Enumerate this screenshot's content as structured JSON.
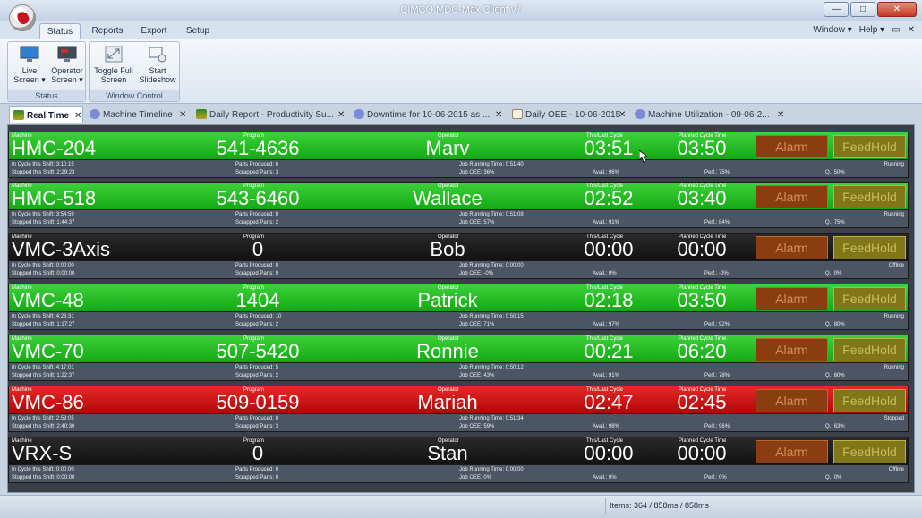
{
  "window": {
    "title": "CIMCO MDC-Max Client v7"
  },
  "ribbon": {
    "tabs": [
      "Status",
      "Reports",
      "Export",
      "Setup"
    ],
    "right_menus": [
      "Window",
      "Help"
    ],
    "groups": [
      {
        "label": "Status",
        "buttons": [
          "Live Screen",
          "Operator Screen"
        ]
      },
      {
        "label": "Window Control",
        "buttons": [
          "Toggle Full Screen",
          "Start Slideshow"
        ]
      }
    ]
  },
  "doc_tabs": [
    "Real Time",
    "Machine Timeline",
    "Daily Report - Productivity Su...",
    "Downtime for 10-06-2015 as ...",
    "Daily OEE - 10-06-2015",
    "Machine Utilization - 09-06-2..."
  ],
  "labels": {
    "machine": "Machine",
    "program": "Program",
    "operator": "Operator",
    "this_last_cycle": "This/Last Cycle",
    "planned_cycle_time": "Planned Cycle Time",
    "alarm": "Alarm",
    "feedhold": "FeedHold",
    "in_cycle": "In Cycle this Shift:",
    "stopped": "Stopped this Shift:",
    "parts_produced": "Parts Produced:",
    "scrapped_parts": "Scrapped Parts:",
    "job_running_time": "Job Running Time:",
    "job_oee": "Job OEE:",
    "avail": "Avail.:",
    "perf": "Perf.:",
    "q": "Q.:"
  },
  "machines": [
    {
      "state": "green",
      "name": "HMC-204",
      "program": "541-4636",
      "operator": "Marv",
      "this_last": "03:51",
      "planned": "03:50",
      "in_cycle": "3:10:15",
      "stopped": "2:29:23",
      "parts": "6",
      "scrapped": "3",
      "job_time": "0:51:40",
      "job_oee": "36%",
      "avail": "96%",
      "perf": "75%",
      "q": "50%",
      "status": "Running"
    },
    {
      "state": "green",
      "name": "HMC-518",
      "program": "543-6460",
      "operator": "Wallace",
      "this_last": "02:52",
      "planned": "03:40",
      "in_cycle": "3:54:59",
      "stopped": "1:44:37",
      "parts": "8",
      "scrapped": "2",
      "job_time": "0:51:08",
      "job_oee": "57%",
      "avail": "91%",
      "perf": "84%",
      "q": "75%",
      "status": "Running"
    },
    {
      "state": "black",
      "name": "VMC-3Axis",
      "program": "0",
      "operator": "Bob",
      "this_last": "00:00",
      "planned": "00:00",
      "in_cycle": "0:00:00",
      "stopped": "0:00:00",
      "parts": "0",
      "scrapped": "0",
      "job_time": "0:00:00",
      "job_oee": "-0%",
      "avail": "0%",
      "perf": "-0%",
      "q": "0%",
      "status": "Offline"
    },
    {
      "state": "green",
      "name": "VMC-48",
      "program": "1404",
      "operator": "Patrick",
      "this_last": "02:18",
      "planned": "03:50",
      "in_cycle": "4:26:31",
      "stopped": "1:17:27",
      "parts": "10",
      "scrapped": "2",
      "job_time": "0:50:15",
      "job_oee": "71%",
      "avail": "97%",
      "perf": "92%",
      "q": "80%",
      "status": "Running"
    },
    {
      "state": "green",
      "name": "VMC-70",
      "program": "507-5420",
      "operator": "Ronnie",
      "this_last": "00:21",
      "planned": "06:20",
      "in_cycle": "4:17:01",
      "stopped": "1:22:37",
      "parts": "5",
      "scrapped": "2",
      "job_time": "0:50:12",
      "job_oee": "43%",
      "avail": "91%",
      "perf": "78%",
      "q": "60%",
      "status": "Running"
    },
    {
      "state": "red",
      "name": "VMC-86",
      "program": "509-0159",
      "operator": "Mariah",
      "this_last": "02:47",
      "planned": "02:45",
      "in_cycle": "2:59:05",
      "stopped": "2:40:30",
      "parts": "8",
      "scrapped": "3",
      "job_time": "0:51:34",
      "job_oee": "59%",
      "avail": "98%",
      "perf": "96%",
      "q": "63%",
      "status": "Stopped"
    },
    {
      "state": "black",
      "name": "VRX-S",
      "program": "0",
      "operator": "Stan",
      "this_last": "00:00",
      "planned": "00:00",
      "in_cycle": "0:00:00",
      "stopped": "0:00:00",
      "parts": "0",
      "scrapped": "0",
      "job_time": "0:00:00",
      "job_oee": "0%",
      "avail": "0%",
      "perf": "0%",
      "q": "0%",
      "status": "Offline"
    }
  ],
  "statusbar": {
    "text": "Items: 364 / 858ms / 858ms"
  }
}
